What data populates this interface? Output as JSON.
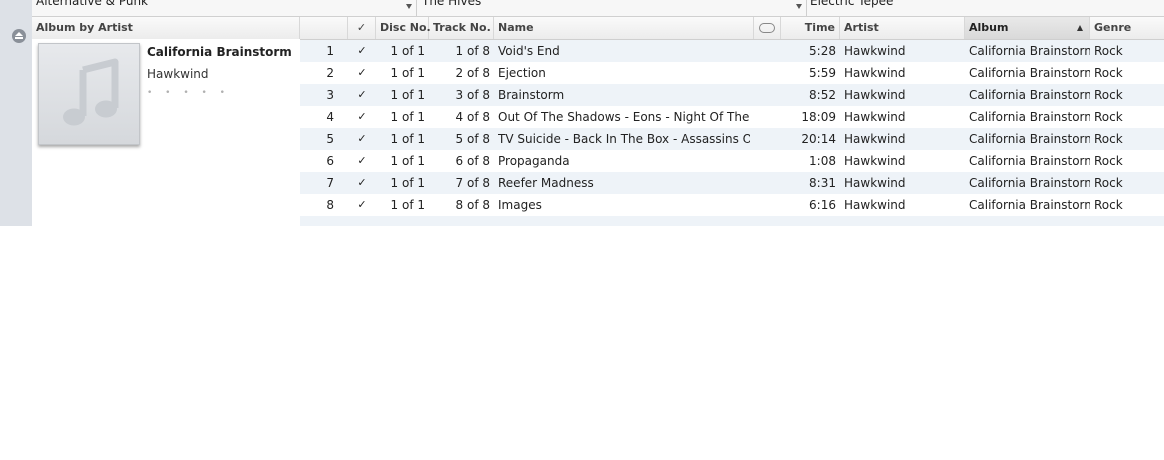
{
  "browser": {
    "genre": "Alternative & Punk",
    "artist": "The Hives",
    "album": "Electric Tepee"
  },
  "header": {
    "group_label": "Album by Artist",
    "check": "✓",
    "disc_no": "Disc No.",
    "track_no": "Track No.",
    "name": "Name",
    "time": "Time",
    "artist": "Artist",
    "album": "Album",
    "genre": "Genre"
  },
  "album": {
    "title": "California Brainstorm",
    "artist": "Hawkwind",
    "rating": "• • • • •"
  },
  "tracks": [
    {
      "num": "1",
      "check": "✓",
      "disc": "1 of 1",
      "track": "1 of 8",
      "name": "Void's End",
      "time": "5:28",
      "artist": "Hawkwind",
      "album": "California Brainstorm",
      "genre": "Rock"
    },
    {
      "num": "2",
      "check": "✓",
      "disc": "1 of 1",
      "track": "2 of 8",
      "name": "Ejection",
      "time": "5:59",
      "artist": "Hawkwind",
      "album": "California Brainstorm",
      "genre": "Rock"
    },
    {
      "num": "3",
      "check": "✓",
      "disc": "1 of 1",
      "track": "3 of 8",
      "name": "Brainstorm",
      "time": "8:52",
      "artist": "Hawkwind",
      "album": "California Brainstorm",
      "genre": "Rock"
    },
    {
      "num": "4",
      "check": "✓",
      "disc": "1 of 1",
      "track": "4 of 8",
      "name": "Out Of The Shadows - Eons - Night Of The H...",
      "time": "18:09",
      "artist": "Hawkwind",
      "album": "California Brainstorm",
      "genre": "Rock"
    },
    {
      "num": "5",
      "check": "✓",
      "disc": "1 of 1",
      "track": "5 of 8",
      "name": "TV Suicide - Back In The Box - Assassins Of Al...",
      "time": "20:14",
      "artist": "Hawkwind",
      "album": "California Brainstorm",
      "genre": "Rock"
    },
    {
      "num": "6",
      "check": "✓",
      "disc": "1 of 1",
      "track": "6 of 8",
      "name": "Propaganda",
      "time": "1:08",
      "artist": "Hawkwind",
      "album": "California Brainstorm",
      "genre": "Rock"
    },
    {
      "num": "7",
      "check": "✓",
      "disc": "1 of 1",
      "track": "7 of 8",
      "name": "Reefer Madness",
      "time": "8:31",
      "artist": "Hawkwind",
      "album": "California Brainstorm",
      "genre": "Rock"
    },
    {
      "num": "8",
      "check": "✓",
      "disc": "1 of 1",
      "track": "8 of 8",
      "name": "Images",
      "time": "6:16",
      "artist": "Hawkwind",
      "album": "California Brainstorm",
      "genre": "Rock"
    }
  ],
  "icons": {
    "eject": "eject-icon",
    "cloud": "cloud-icon",
    "note": "music-note-icon",
    "sort": "sort-ascending-icon",
    "dropdown": "chevron-down-icon"
  },
  "colors": {
    "row_alt": "#eef3f8",
    "sidebar": "#dde1e7"
  }
}
